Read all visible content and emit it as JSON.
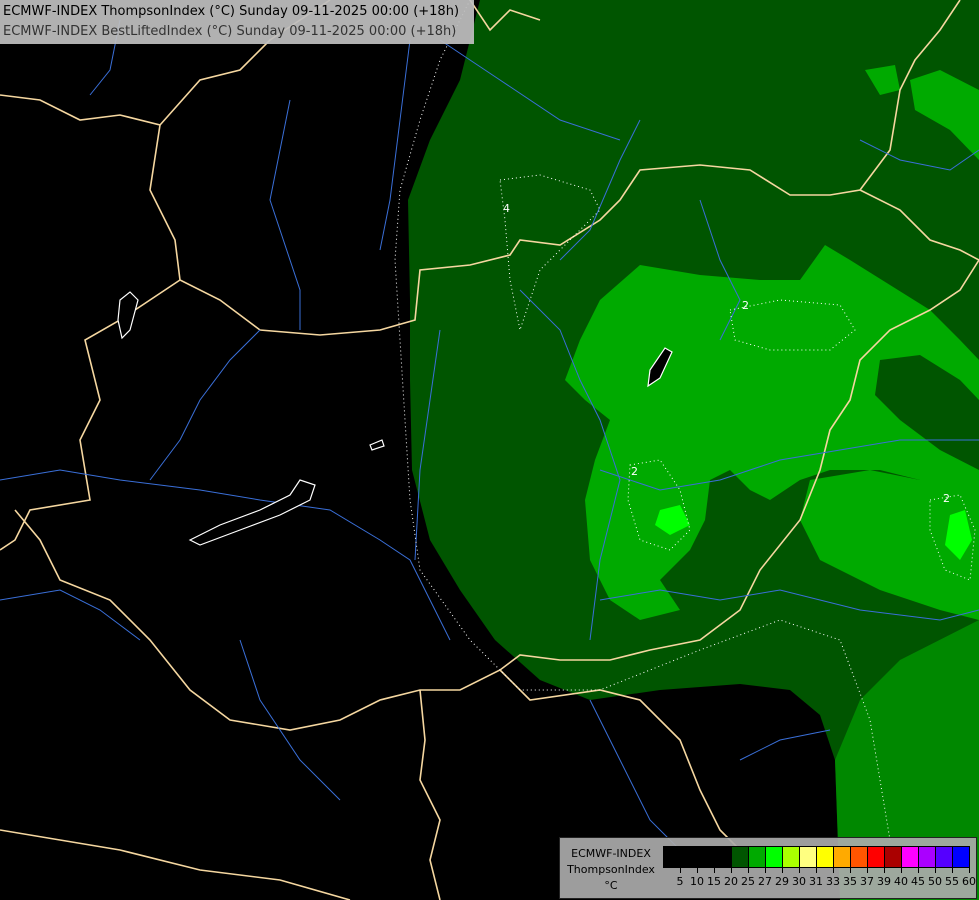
{
  "header": {
    "line1": "ECMWF-INDEX ThompsonIndex (°C) Sunday 09-11-2025 00:00 (+18h)",
    "line2": "ECMWF-INDEX BestLiftedIndex (°C) Sunday 09-11-2025 00:00 (+18h)"
  },
  "contour_labels": [
    "4",
    "2",
    "2",
    "2"
  ],
  "legend": {
    "line1": "ECMWF-INDEX",
    "line2": "ThompsonIndex",
    "unit": "°C",
    "colors": [
      "#000000",
      "#000000",
      "#000000",
      "#000000",
      "#005500",
      "#00aa00",
      "#00ff00",
      "#aaff00",
      "#ffff80",
      "#ffff00",
      "#ffaa00",
      "#ff5500",
      "#ff0000",
      "#aa0000",
      "#ff00ff",
      "#aa00ff",
      "#5500ff",
      "#0000ff"
    ],
    "ticks": [
      "5",
      "10",
      "15",
      "20",
      "25",
      "27",
      "29",
      "30",
      "31",
      "33",
      "35",
      "37",
      "39",
      "40",
      "45",
      "50",
      "55",
      "60"
    ]
  },
  "colors": {
    "dark_green": "#005500",
    "mid_green": "#00aa00",
    "bright_green": "#00ff00",
    "border": "#f5d7a0",
    "river": "#3a6fd8"
  }
}
